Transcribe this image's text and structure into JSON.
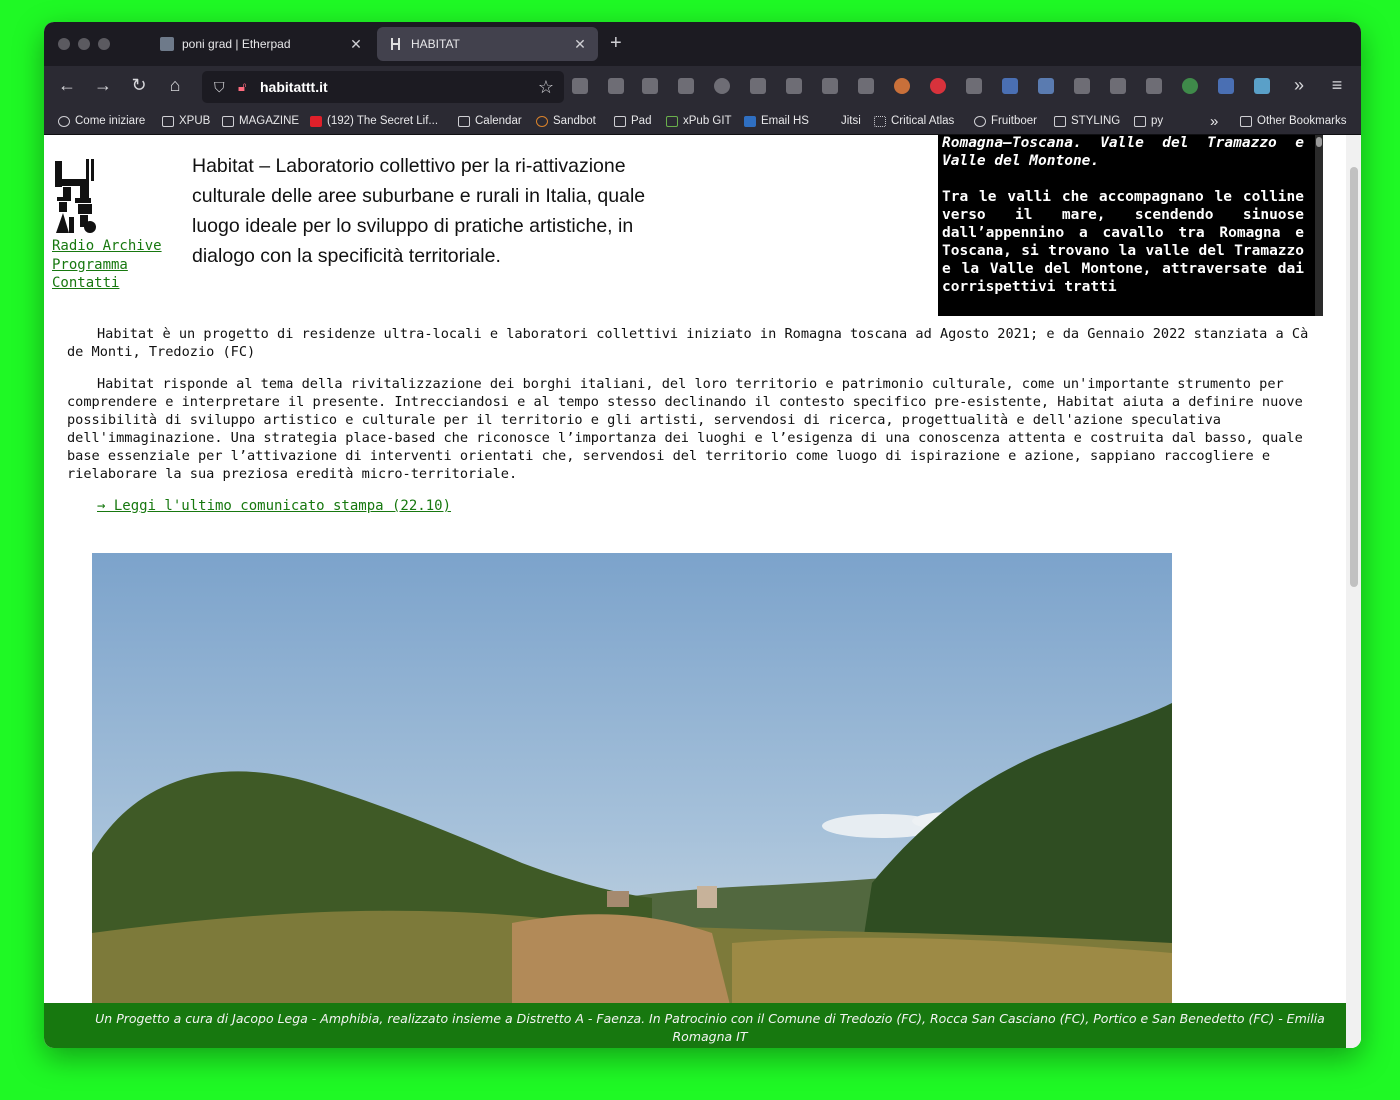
{
  "browser": {
    "tabs": [
      {
        "title": "poni grad | Etherpad",
        "active": false
      },
      {
        "title": "HABITAT",
        "active": true
      }
    ],
    "url": "habitattt.it",
    "bookmarks": [
      "Come iniziare",
      "XPUB",
      "MAGAZINE",
      "(192) The Secret Lif...",
      "Calendar",
      "Sandbot",
      "Pad",
      "xPub GIT",
      "Email HS",
      "Jitsi",
      "Critical Atlas",
      "Fruitboer",
      "STYLING",
      "py",
      "Other Bookmarks"
    ],
    "overflow_glyph": "»"
  },
  "site": {
    "nav": [
      "Radio Archive",
      "Programma",
      "Contatti"
    ],
    "tagline": "Habitat – Laboratorio collettivo per la ri-attivazione culturale delle aree suburbane e rurali in Italia, quale luogo ideale per lo sviluppo di pratiche artistiche, in dialogo con la specificità territoriale.",
    "side_box": {
      "heading": "Romagna–Toscana. Valle del Tramazzo e Valle del Montone.",
      "body": "Tra le valli che accompagnano le colline verso il mare, scendendo sinuose dall’appennino a cavallo tra Romagna e Toscana, si trovano la valle del Tramazzo e la Valle del Montone, attraversate dai corrispettivi tratti"
    },
    "paragraph_1": "Habitat è un progetto di residenze ultra-locali e laboratori collettivi iniziato in Romagna toscana ad Agosto 2021; e da Gennaio 2022 stanziata a Cà de Monti, Tredozio (FC)",
    "paragraph_2": "Habitat risponde al tema della rivitalizzazione dei borghi italiani, del loro territorio e patrimonio culturale, come un'importante strumento per comprendere e interpretare il presente. Intrecciandosi e al tempo stesso declinando il contesto specifico pre-esistente, Habitat aiuta a definire nuove possibilità di sviluppo artistico e culturale per il territorio e gli artisti, servendosi di ricerca, progettualità e dell'azione speculativa dell'immaginazione. Una strategia place-based che riconosce l’importanza dei luoghi e l’esigenza di una conoscenza attenta e costruita dal basso, quale base essenziale per l’attivazione di interventi orientati che, servendosi del territorio come luogo di ispirazione e azione, sappiano raccogliere e rielaborare la sua preziosa eredità micro-territoriale.",
    "press_link": "→ Leggi l'ultimo comunicato stampa (22.10)",
    "footer": "Un Progetto a cura di Jacopo Lega - Amphibia, realizzato insieme a Distretto A - Faenza. In Patrocinio con il Comune di Tredozio (FC), Rocca San Casciano (FC), Portico e San Benedetto (FC) - Emilia Romagna IT"
  },
  "colors": {
    "background": "#1ff925",
    "accent_green": "#17780f",
    "tab_active": "#42414d",
    "toolbar": "#2b2a33"
  }
}
